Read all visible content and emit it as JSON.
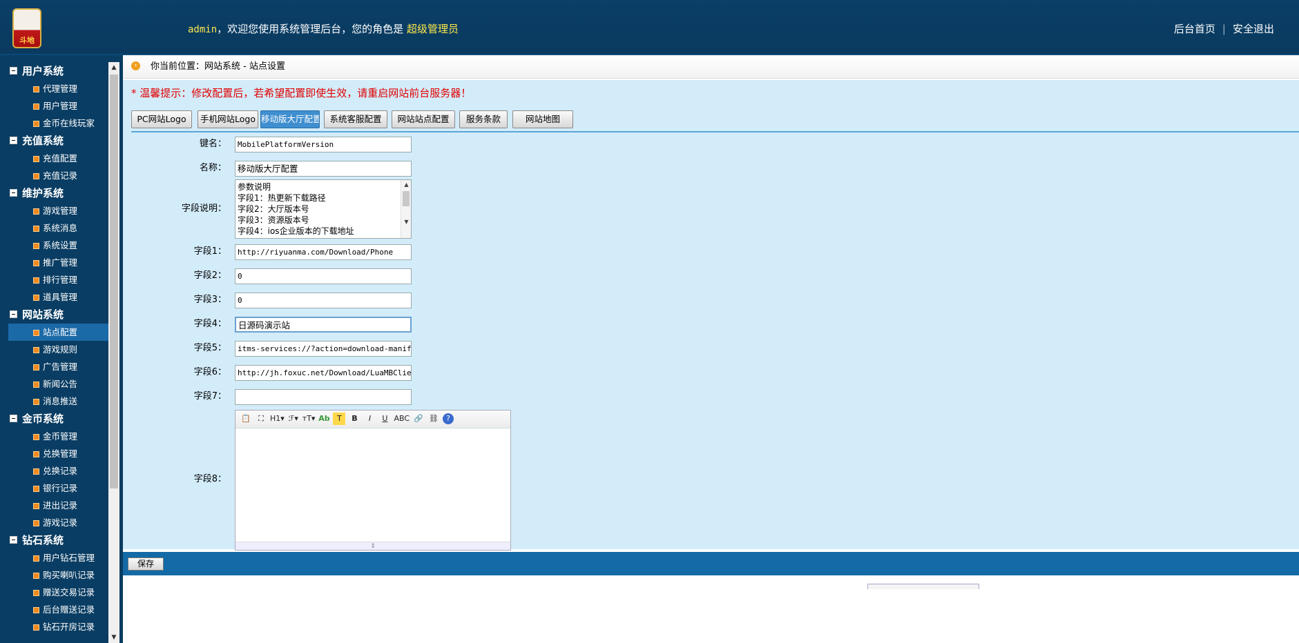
{
  "header": {
    "logo_text": "斗地",
    "welcome_user": "admin",
    "welcome_text": "，欢迎您使用系统管理后台，您的角色是",
    "role": "超级管理员",
    "links": [
      "后台首页",
      "安全退出"
    ]
  },
  "sidebar": {
    "groups": [
      {
        "title": "用户系统",
        "items": [
          "代理管理",
          "用户管理",
          "金币在线玩家"
        ]
      },
      {
        "title": "充值系统",
        "items": [
          "充值配置",
          "充值记录"
        ]
      },
      {
        "title": "维护系统",
        "items": [
          "游戏管理",
          "系统消息",
          "系统设置",
          "推广管理",
          "排行管理",
          "道具管理"
        ]
      },
      {
        "title": "网站系统",
        "items": [
          "站点配置",
          "游戏规则",
          "广告管理",
          "新闻公告",
          "消息推送"
        ]
      },
      {
        "title": "金币系统",
        "items": [
          "金币管理",
          "兑换管理",
          "兑换记录",
          "银行记录",
          "进出记录",
          "游戏记录"
        ]
      },
      {
        "title": "钻石系统",
        "items": [
          "用户钻石管理",
          "购买喇叭记录",
          "赠送交易记录",
          "后台赠送记录",
          "钻石开房记录"
        ]
      }
    ],
    "active_item": "站点配置"
  },
  "breadcrumb": "你当前位置：网站系统 - 站点设置",
  "tip": "* 温馨提示：修改配置后，若希望配置即使生效，请重启网站前台服务器！",
  "tabs": [
    "PC网站Logo",
    "手机网站Logo",
    "移动版大厅配置",
    "系统客服配置",
    "网站站点配置",
    "服务条款",
    "网站地图"
  ],
  "active_tab": "移动版大厅配置",
  "form": {
    "key_label": "键名：",
    "key_value": "MobilePlatformVersion",
    "name_label": "名称：",
    "name_value": "移动版大厅配置",
    "desc_label": "字段说明：",
    "desc_lines": [
      "参数说明",
      "字段1：热更新下载路径",
      "字段2：大厅版本号",
      "字段3：资源版本号",
      "字段4：ios企业版本的下载地址"
    ],
    "fields": [
      {
        "label": "字段1：",
        "value": "http://riyuanma.com/Download/Phone"
      },
      {
        "label": "字段2：",
        "value": "0"
      },
      {
        "label": "字段3：",
        "value": "0"
      },
      {
        "label": "字段4：",
        "value": "日源码演示站"
      },
      {
        "label": "字段5：",
        "value": "itms-services://?action=download-manifest&"
      },
      {
        "label": "字段6：",
        "value": "http://jh.foxuc.net/Download/LuaMBClient_I"
      },
      {
        "label": "字段7：",
        "value": ""
      }
    ],
    "field8_label": "字段8：",
    "editor_toolbar": [
      "📋",
      "⛶",
      "H1▾",
      "ℱ▾",
      "тT▾",
      "Ab",
      "T",
      "B",
      "I",
      "U",
      "ABC",
      "🔗",
      "⛓",
      "?"
    ]
  },
  "save_label": "保存"
}
